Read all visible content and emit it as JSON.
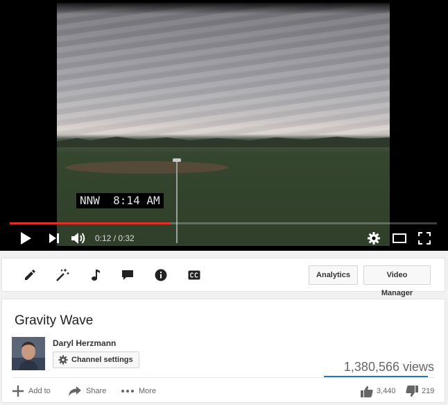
{
  "player": {
    "overlay_text": "NNW  8:14 AM",
    "time_display": "0:12 / 0:32",
    "progress_fraction": 0.375,
    "buffered_fraction": 0.375,
    "accent": "#e52d27",
    "controls": {
      "play": "play-icon",
      "next": "next-icon",
      "volume": "volume-icon",
      "settings": "gear-icon",
      "theater": "theater-mode-icon",
      "fullscreen": "fullscreen-icon"
    }
  },
  "toolbar": {
    "tools": [
      "edit-pencil-icon",
      "magic-wand-icon",
      "audio-note-icon",
      "annotations-icon",
      "info-icon",
      "cc-icon"
    ],
    "analytics_label": "Analytics",
    "video_manager_label": "Video Manager"
  },
  "video": {
    "title": "Gravity Wave",
    "owner": "Daryl Herzmann",
    "channel_settings_label": "Channel settings",
    "views": "1,380,566 views",
    "sentiment_color": "#167ac6",
    "actions": {
      "add_to": "Add to",
      "share": "Share",
      "more": "More"
    },
    "likes": "3,440",
    "dislikes": "219"
  }
}
